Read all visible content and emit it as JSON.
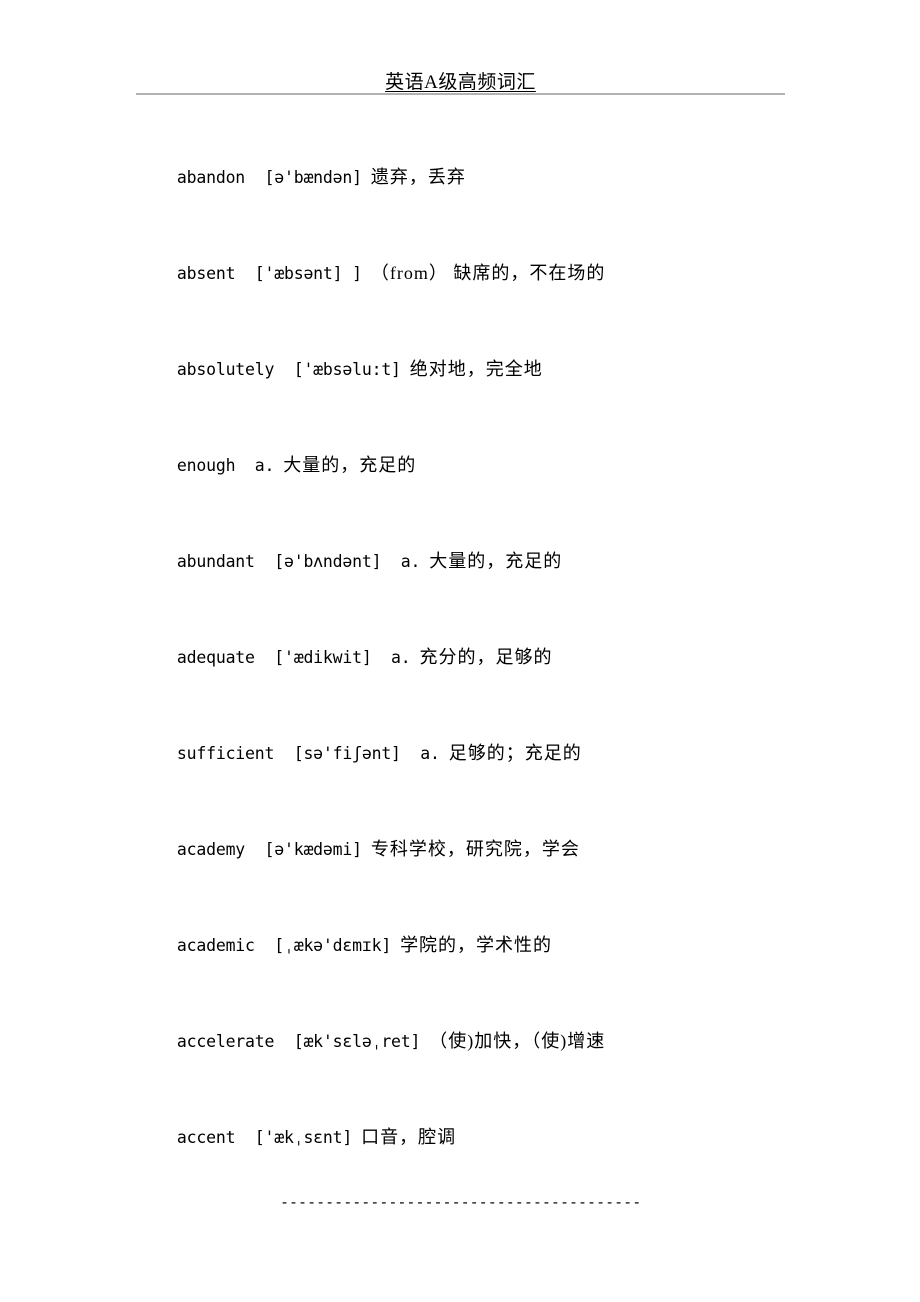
{
  "document": {
    "title": "英语A级高频词汇",
    "page_background": "#ffffff",
    "text_color": "#000000",
    "rule_color": "#b2b2b2"
  },
  "header": {
    "title": "英语A级高频词汇"
  },
  "entries": [
    {
      "word": "abandon",
      "ipa": "[ə'bændən]",
      "pos": "",
      "definition": "遗弃，丢弃",
      "line_latin": "abandon  [ə'bændən]",
      "line_cjk": "遗弃，丢弃"
    },
    {
      "word": "absent",
      "ipa": "['æbsənt] ]",
      "pos": "",
      "definition": "（from） 缺席的，不在场的",
      "line_latin": "absent  ['æbsənt] ]",
      "line_cjk": "（from） 缺席的，不在场的"
    },
    {
      "word": "absolutely",
      "ipa": "['æbsəlu:t]",
      "pos": "",
      "definition": "绝对地，完全地",
      "line_latin": "absolutely  ['æbsəlu:t]",
      "line_cjk": "绝对地，完全地"
    },
    {
      "word": "enough",
      "ipa": "",
      "pos": "a.",
      "definition": "大量的，充足的",
      "line_latin": "enough  a.",
      "line_cjk": "大量的，充足的"
    },
    {
      "word": "abundant",
      "ipa": "[ə'bʌndənt]",
      "pos": "a.",
      "definition": "大量的，充足的",
      "line_latin": "abundant  [ə'bʌndənt]  a.",
      "line_cjk": "大量的，充足的"
    },
    {
      "word": "adequate",
      "ipa": "['ædikwit]",
      "pos": "a.",
      "definition": "充分的，足够的",
      "line_latin": "adequate  ['ædikwit]  a.",
      "line_cjk": "充分的，足够的"
    },
    {
      "word": "sufficient",
      "ipa": "[sə'fiʃənt]",
      "pos": "a.",
      "definition": "足够的；充足的",
      "line_latin": "sufficient  [sə'fiʃənt]  a.",
      "line_cjk": "足够的；充足的"
    },
    {
      "word": "academy",
      "ipa": "[ə'kædəmi]",
      "pos": "",
      "definition": "专科学校，研究院，学会",
      "line_latin": "academy  [ə'kædəmi]",
      "line_cjk": "专科学校，研究院，学会"
    },
    {
      "word": "academic",
      "ipa": "[ˌækə'dɛmɪk]",
      "pos": "",
      "definition": "学院的，学术性的",
      "line_latin": "academic  [ˌækə'dɛmɪk]",
      "line_cjk": "学院的，学术性的"
    },
    {
      "word": "accelerate",
      "ipa": "[æk'sɛləˌret]",
      "pos": "",
      "definition": "（使)加快，（使)增速",
      "line_latin": "accelerate  [æk'sɛləˌret]",
      "line_cjk": "（使)加快，（使)增速"
    },
    {
      "word": "accent",
      "ipa": "['ækˌsɛnt]",
      "pos": "",
      "definition": "口音，腔调",
      "line_latin": "accent  ['ækˌsɛnt]",
      "line_cjk": "口音，腔调"
    }
  ],
  "footer": {
    "separator": "------------------------------------------------------"
  }
}
